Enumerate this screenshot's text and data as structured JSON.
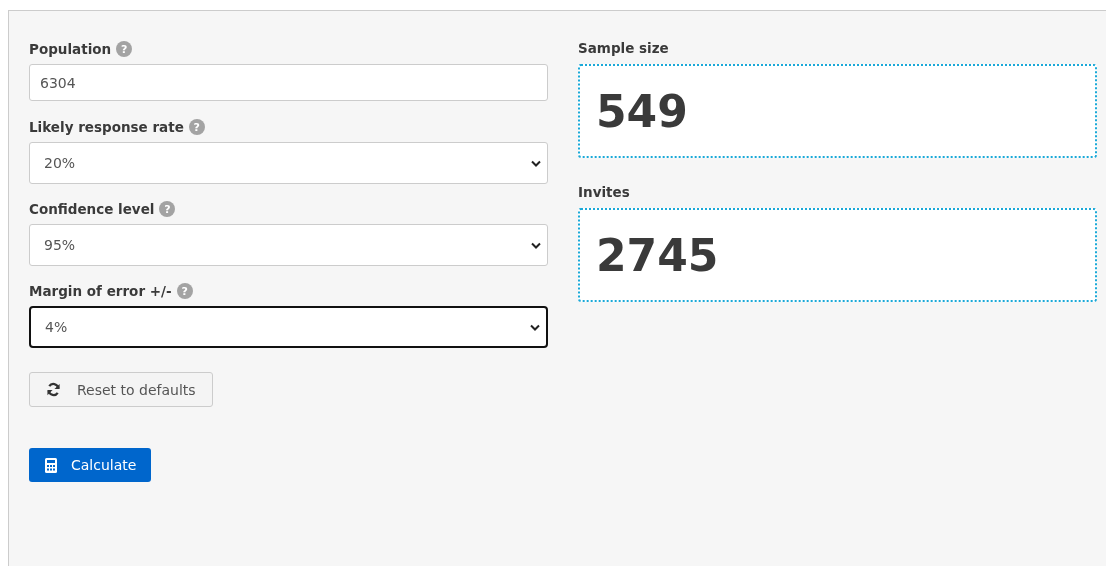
{
  "fields": [
    {
      "label": "Population",
      "help": "?",
      "kind": "input",
      "value": "6304",
      "focused": false
    },
    {
      "label": "Likely response rate",
      "help": "?",
      "kind": "select",
      "value": "20%",
      "focused": false
    },
    {
      "label": "Confidence level",
      "help": "?",
      "kind": "select",
      "value": "95%",
      "focused": false
    },
    {
      "label": "Margin of error +/-",
      "help": "?",
      "kind": "select",
      "value": "4%",
      "focused": true
    }
  ],
  "reset_button": {
    "label": "Reset to defaults"
  },
  "calculate_button": {
    "label": "Calculate"
  },
  "results": [
    {
      "label": "Sample size",
      "value": "549"
    },
    {
      "label": "Invites",
      "value": "2745"
    }
  ]
}
